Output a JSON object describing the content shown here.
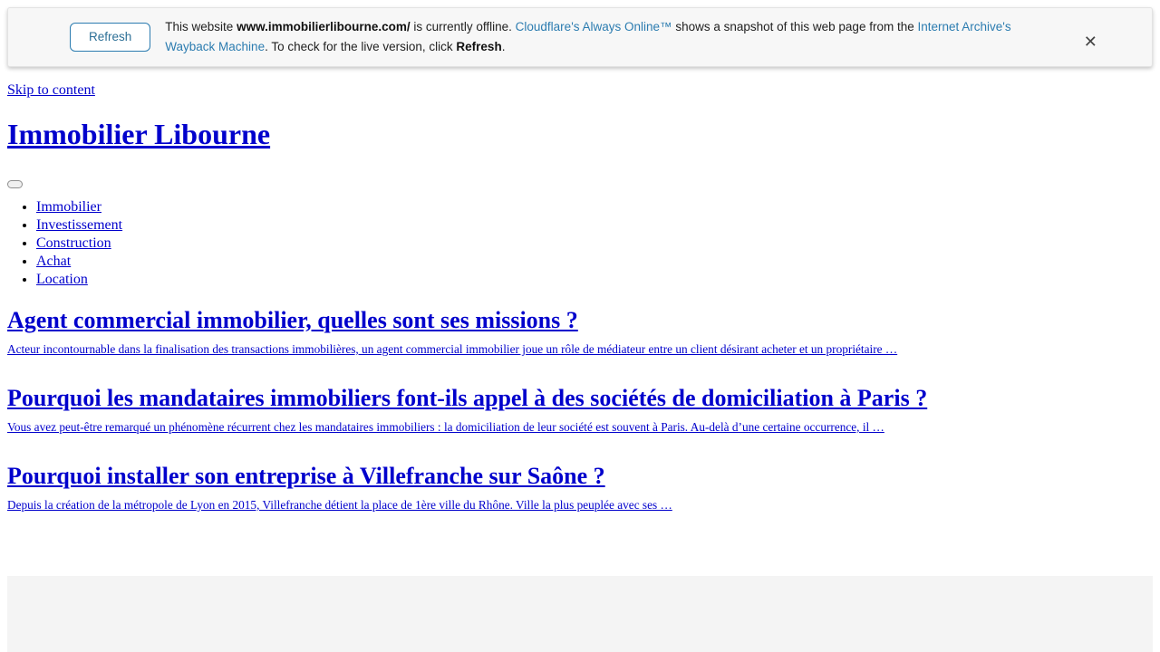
{
  "cloudflare_banner": {
    "refresh_button_label": "Refresh",
    "message_part1": "This website ",
    "site_domain": "www.immobilierlibourne.com/",
    "message_part2": " is currently offline. ",
    "link_always_online": "Cloudflare's Always Online™",
    "message_part3": " shows a snapshot of this web page from the ",
    "link_internet_archive": "Internet Archive's Wayback Machine",
    "message_part4": ". To check for the live version, click ",
    "refresh_word": "Refresh",
    "message_part5": ".",
    "close_icon": "✕",
    "accent_color": "#2c7cb0",
    "background_color": "#f7f7f7"
  },
  "page": {
    "skip_link": "Skip to content",
    "site_title": "Immobilier Libourne",
    "menu_toggle_name": "menu-toggle-button",
    "nav_items": [
      {
        "label": "Immobilier"
      },
      {
        "label": "Investissement"
      },
      {
        "label": "Construction"
      },
      {
        "label": "Achat"
      },
      {
        "label": "Location"
      }
    ],
    "posts": [
      {
        "title": "Agent commercial immobilier, quelles sont ses missions ?",
        "excerpt": "Acteur incontournable dans la finalisation des transactions immobilières, un agent commercial immobilier joue un rôle de médiateur entre un client désirant acheter et un propriétaire …"
      },
      {
        "title": "Pourquoi les mandataires immobiliers font-ils appel à des sociétés de domiciliation à Paris ?",
        "excerpt": "Vous avez peut-être remarqué un phénomène récurrent chez les mandataires immobiliers : la domiciliation de leur société est souvent à Paris. Au-delà d’une certaine occurrence, il …"
      },
      {
        "title": "Pourquoi installer son entreprise à Villefranche sur Saône ?",
        "excerpt": "Depuis la création de la métropole de Lyon en 2015, Villefranche détient la place de 1ère ville du Rhône. Ville la plus peuplée avec ses …"
      }
    ],
    "link_color": "#0000cc",
    "footer_block_color": "#f4f4f4"
  }
}
